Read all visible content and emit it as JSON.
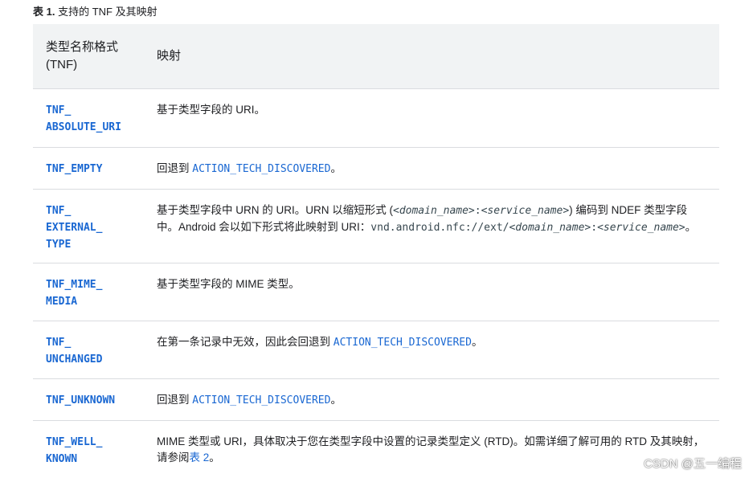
{
  "caption": {
    "label": "表 1.",
    "text": " 支持的 TNF 及其映射"
  },
  "table": {
    "headers": {
      "col1_line1": "类型名称格式",
      "col1_line2": "(TNF)",
      "col2": "映射"
    },
    "rows": [
      {
        "tnf": "TNF_\nABSOLUTE_URI",
        "mapping": "基于类型字段的 URI。"
      },
      {
        "tnf": "TNF_EMPTY",
        "mapping_prefix": "回退到 ",
        "mapping_code": "ACTION_TECH_DISCOVERED",
        "mapping_suffix": "。"
      },
      {
        "tnf": "TNF_\nEXTERNAL_\nTYPE",
        "p1": "基于类型字段中 URN 的 URI。URN 以缩短形式 (",
        "p2": "<domain_name>",
        "p3": ":",
        "p4": "<service_name>",
        "p5": ") 编码到 NDEF 类型字段中。Android 会以如下形式将此映射到 URI：",
        "p6": "vnd.android.nfc://ext/",
        "p7": "<domain_name>",
        "p8": ":",
        "p9": "<service_name>",
        "p10": "。"
      },
      {
        "tnf": "TNF_MIME_\nMEDIA",
        "mapping": "基于类型字段的 MIME 类型。"
      },
      {
        "tnf": "TNF_\nUNCHANGED",
        "mapping_prefix": "在第一条记录中无效，因此会回退到 ",
        "mapping_code": "ACTION_TECH_DISCOVERED",
        "mapping_suffix": "。"
      },
      {
        "tnf": "TNF_UNKNOWN",
        "mapping_prefix": "回退到 ",
        "mapping_code": "ACTION_TECH_DISCOVERED",
        "mapping_suffix": "。"
      },
      {
        "tnf": "TNF_WELL_\nKNOWN",
        "mapping_prefix": "MIME 类型或 URI，具体取决于您在类型字段中设置的记录类型定义 (RTD)。如需详细了解可用的 RTD 及其映射，请参阅",
        "mapping_link": "表 2",
        "mapping_suffix": "。"
      }
    ]
  },
  "watermark": "CSDN @五一编程"
}
